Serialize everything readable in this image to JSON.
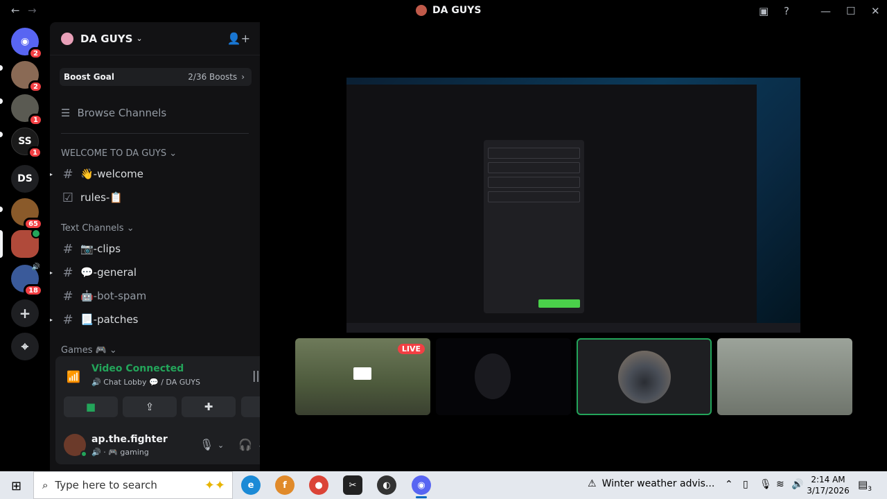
{
  "window": {
    "title": "DA GUYS",
    "back_icon": "←",
    "forward_icon": "→",
    "minimize": "—",
    "maximize": "☐",
    "close": "✕"
  },
  "rail": {
    "servers": [
      {
        "name": "discord-home",
        "label": "",
        "badge": "2",
        "color": "#5865f2"
      },
      {
        "name": "dm-avatar-1",
        "label": "",
        "badge": "2",
        "color": "#8a6a55"
      },
      {
        "name": "dm-avatar-2",
        "label": "",
        "badge": "1",
        "color": "#5a5a52"
      },
      {
        "name": "server-ss",
        "label": "SS",
        "badge": "1",
        "color": "#1a1a1a"
      },
      {
        "name": "server-ds",
        "label": "DS",
        "badge": "",
        "color": "#1e1f22"
      },
      {
        "name": "server-gifts",
        "label": "",
        "badge": "65",
        "color": "#8a5a2a"
      },
      {
        "name": "server-da-guys",
        "label": "",
        "badge": "",
        "color": "#b04a3a"
      },
      {
        "name": "server-voice",
        "label": "",
        "badge": "18",
        "color": "#3a5a9a"
      }
    ],
    "add_server": "+",
    "discover": "⌖"
  },
  "sidebar": {
    "server_name": "DA GUYS",
    "boost_label": "Boost Goal",
    "boost_count": "2/36 Boosts",
    "browse": "Browse Channels",
    "categories": {
      "welcome": "WELCOME TO DA GUYS",
      "text": "Text Channels",
      "games": "Games 🎮"
    },
    "channels": [
      {
        "label": "👋-welcome",
        "icon": "#"
      },
      {
        "label": "rules-📋",
        "icon": "☑"
      },
      {
        "label": "📷-clips",
        "icon": "#"
      },
      {
        "label": "💬-general",
        "icon": "#"
      },
      {
        "label": "🤖-bot-spam",
        "icon": "#"
      },
      {
        "label": "📃-patches",
        "icon": "#"
      }
    ]
  },
  "voice": {
    "status": "Video Connected",
    "location": "🔊 Chat Lobby 💬 / DA GUYS"
  },
  "user": {
    "name": "ap.the.fighter",
    "status": "🔊 · 🎮 gaming"
  },
  "stage": {
    "live_badge": "LIVE"
  },
  "taskbar": {
    "search_placeholder": "Type here to search",
    "weather": "Winter weather advis...",
    "time": "2:14 AM",
    "date": "3/17/2026",
    "notif_count": "3"
  }
}
